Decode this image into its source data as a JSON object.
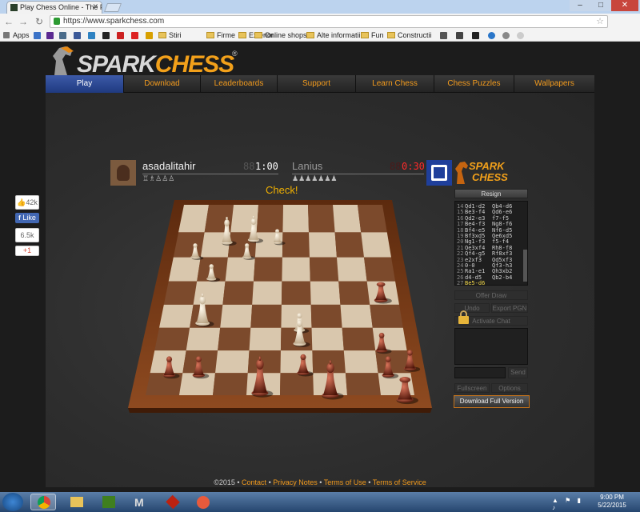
{
  "browser": {
    "tab_title": "Play Chess Online - The P",
    "url": "https://www.sparkchess.com",
    "bookmarks": [
      "Apps",
      "Stiri",
      "Firme",
      "Exterior",
      "Online shops",
      "Alte informatii",
      "Fun",
      "Constructii"
    ]
  },
  "site": {
    "logo_text_a": "SPARK",
    "logo_text_b": "CHESS",
    "logo_mark": "®",
    "nav": [
      "Play",
      "Download",
      "Leaderboards",
      "Support",
      "Learn Chess",
      "Chess Puzzles",
      "Wallpapers"
    ],
    "nav_active": "Play"
  },
  "social": {
    "count": "42k",
    "like": "Like",
    "share_count": "6.5k",
    "gplus": "+1"
  },
  "game": {
    "player": {
      "name": "asadalitahir",
      "clock": "1:00",
      "captured": "♖♗♙♙♙"
    },
    "opponent": {
      "name": "Lanius",
      "clock": "0:30",
      "captured": "♟♟♟♟♟♟♟"
    },
    "status": "Check!",
    "resign_label": "Resign",
    "moves": [
      {
        "n": "14",
        "w": "Qd1-d2",
        "b": "Qb4-d6"
      },
      {
        "n": "15",
        "w": "Be3-f4",
        "b": "Qd6-e6"
      },
      {
        "n": "16",
        "w": "Qd2-e3",
        "b": "f7-f5"
      },
      {
        "n": "17",
        "w": "Be4-f3",
        "b": "Ng8-f6"
      },
      {
        "n": "18",
        "w": "Bf4-e5",
        "b": "Nf6-d5"
      },
      {
        "n": "19",
        "w": "Bf3xd5",
        "b": "Qe6xd5"
      },
      {
        "n": "20",
        "w": "Ng1-f3",
        "b": "f5-f4"
      },
      {
        "n": "21",
        "w": "Qe3xf4",
        "b": "Rh8-f8"
      },
      {
        "n": "22",
        "w": "Qf4-g5",
        "b": "Rf8xf3"
      },
      {
        "n": "23",
        "w": "e2xf3",
        "b": "Qd5xf3"
      },
      {
        "n": "24",
        "w": "0-0",
        "b": "Qf3-h3"
      },
      {
        "n": "25",
        "w": "Ra1-e1",
        "b": "Qh3xb2"
      },
      {
        "n": "26",
        "w": "d4-d5",
        "b": "Qb2-b4"
      },
      {
        "n": "27",
        "w": "Be5-d6",
        "b": ""
      }
    ],
    "buttons": {
      "offer_draw": "Offer Draw",
      "undo": "Undo",
      "export_pgn": "Export PGN",
      "activate_chat": "Activate Chat",
      "send": "Send",
      "fullscreen": "Fullscreen",
      "options": "Options"
    },
    "download_label": "Download Full Version"
  },
  "footer": {
    "copyright": "©2015 •",
    "links": [
      "Contact",
      "Privacy Notes",
      "Terms of Use",
      "Terms of Service"
    ]
  },
  "taskbar": {
    "time": "9:00 PM",
    "date": "5/22/2015"
  }
}
